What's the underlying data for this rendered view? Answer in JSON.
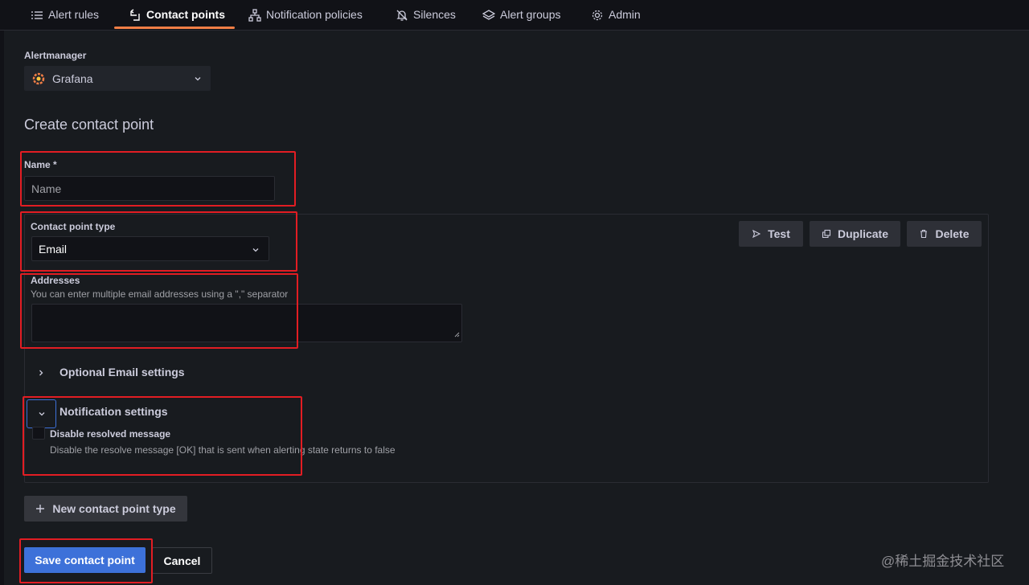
{
  "tabs": [
    {
      "label": "Alert rules",
      "icon": "list-icon"
    },
    {
      "label": "Contact points",
      "icon": "comment-alt-share-icon"
    },
    {
      "label": "Notification policies",
      "icon": "sitemap-icon"
    },
    {
      "label": "Silences",
      "icon": "bell-slash-icon"
    },
    {
      "label": "Alert groups",
      "icon": "layer-group-icon"
    },
    {
      "label": "Admin",
      "icon": "cog-icon"
    }
  ],
  "alertmanager": {
    "label": "Alertmanager",
    "value": "Grafana"
  },
  "page_title": "Create contact point",
  "name_field": {
    "label": "Name *",
    "placeholder": "Name"
  },
  "contact_point": {
    "type_label": "Contact point type",
    "type_value": "Email",
    "buttons": {
      "test": "Test",
      "duplicate": "Duplicate",
      "delete": "Delete"
    },
    "addresses": {
      "label": "Addresses",
      "description": "You can enter multiple email addresses using a \",\" separator"
    },
    "optional_settings": "Optional Email settings",
    "notification_settings": {
      "title": "Notification settings",
      "disable_resolved_label": "Disable resolved message",
      "disable_resolved_desc": "Disable the resolve message [OK] that is sent when alerting state returns to false"
    }
  },
  "new_contact_point_type": "New contact point type",
  "footer": {
    "save": "Save contact point",
    "cancel": "Cancel"
  },
  "watermark": "@稀土掘金技术社区",
  "colors": {
    "accent_orange": "#f37f46",
    "primary_blue": "#3d71d9",
    "highlight_red": "#e21d23"
  }
}
